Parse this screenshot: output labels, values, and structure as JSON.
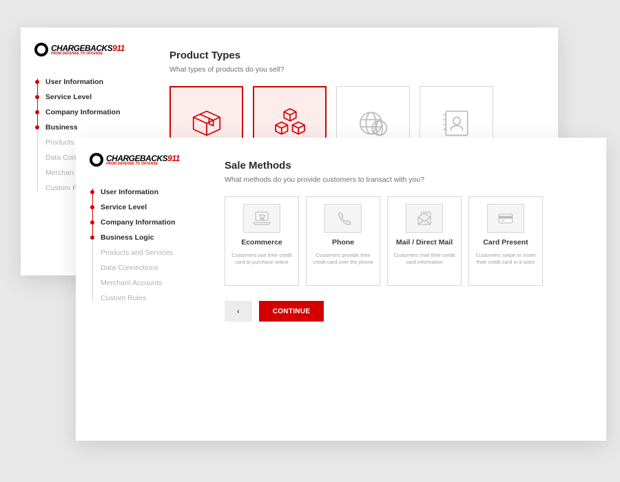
{
  "logo": {
    "word1": "CHARGEBACKS",
    "word2": "911",
    "tagline": "FROM DEFENSE TO OFFENSE"
  },
  "back_window": {
    "title": "Product Types",
    "subtitle": "What types of products do you sell?",
    "steps": [
      {
        "label": "User Information",
        "state": "done"
      },
      {
        "label": "Service Level",
        "state": "done"
      },
      {
        "label": "Company Information",
        "state": "done"
      },
      {
        "label": "Business",
        "state": "active"
      },
      {
        "label": "Products",
        "state": "sub"
      },
      {
        "label": "Data Con",
        "state": "sub"
      },
      {
        "label": "Merchan",
        "state": "sub"
      },
      {
        "label": "Custom R",
        "state": "sub"
      }
    ],
    "cards": [
      {
        "name": "box-icon",
        "selected": true
      },
      {
        "name": "cubes-icon",
        "selected": true
      },
      {
        "name": "globe-icon",
        "selected": false
      },
      {
        "name": "contact-icon",
        "selected": false
      }
    ]
  },
  "front_window": {
    "title": "Sale Methods",
    "subtitle": "What methods do you provide customers to transact with you?",
    "steps": [
      {
        "label": "User Information",
        "state": "done"
      },
      {
        "label": "Service Level",
        "state": "done"
      },
      {
        "label": "Company Information",
        "state": "done"
      },
      {
        "label": "Business Logic",
        "state": "active"
      },
      {
        "label": "Products and Services",
        "state": "sub"
      },
      {
        "label": "Data Connections",
        "state": "sub"
      },
      {
        "label": "Merchant Accounts",
        "state": "sub"
      },
      {
        "label": "Custom Rules",
        "state": "sub"
      }
    ],
    "options": [
      {
        "name": "ecommerce",
        "icon": "laptop-cart-icon",
        "title": "Ecommerce",
        "desc": "Customers use their credit card to purchase online"
      },
      {
        "name": "phone",
        "icon": "phone-icon",
        "title": "Phone",
        "desc": "Customers provide their credit card over the phone"
      },
      {
        "name": "mail",
        "icon": "envelope-icon",
        "title": "Mail / Direct Mail",
        "desc": "Customers mail their credit card information"
      },
      {
        "name": "card-present",
        "icon": "card-icon",
        "title": "Card Present",
        "desc": "Customers swipe or insert their credit card in a store"
      }
    ],
    "actions": {
      "back_glyph": "‹",
      "continue_label": "CONTINUE"
    }
  }
}
